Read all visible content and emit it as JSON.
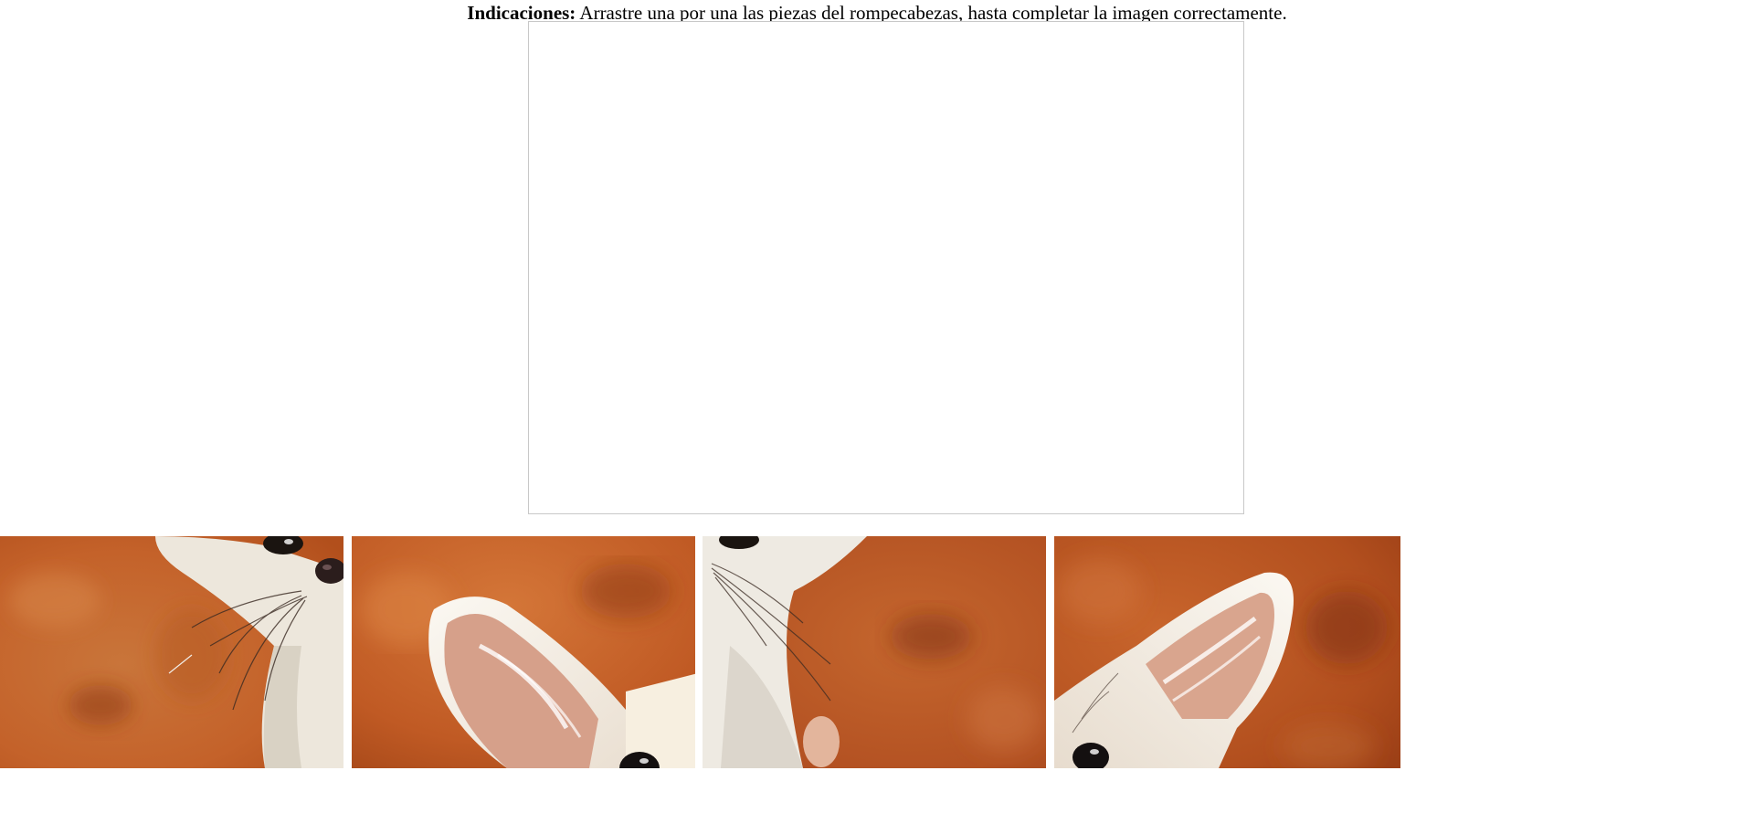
{
  "instructions": {
    "label": "Indicaciones:",
    "text": " Arrastre una por una las piezas del rompecabezas, hasta completar la imagen correctamente."
  },
  "puzzle": {
    "dropzone_border_color": "#c8c8c8",
    "pieces": [
      {
        "name": "puzzle-piece-1",
        "depicts": "fox-snout-whiskers"
      },
      {
        "name": "puzzle-piece-2",
        "depicts": "fox-left-ear"
      },
      {
        "name": "puzzle-piece-3",
        "depicts": "fox-chin-chest"
      },
      {
        "name": "puzzle-piece-4",
        "depicts": "fox-right-ear"
      }
    ]
  },
  "colors": {
    "background_orange": "#c4622a",
    "background_dark": "#8e3a14",
    "fur_white": "#f6f2ea"
  }
}
